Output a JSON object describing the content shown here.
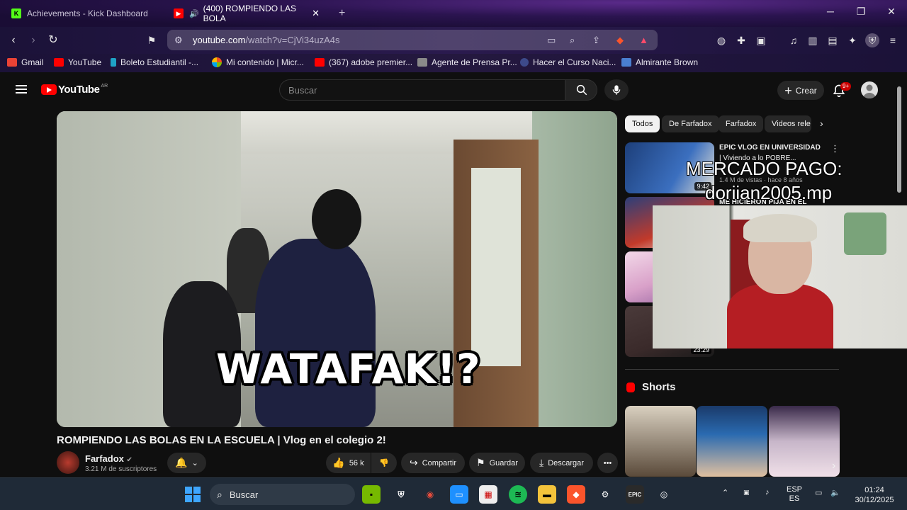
{
  "browser": {
    "tabs": [
      {
        "title": "Achievements - Kick Dashboard",
        "active": false,
        "icon": "kick-icon"
      },
      {
        "title": "(400) ROMPIENDO LAS BOLA",
        "active": true,
        "icon": "youtube-icon"
      }
    ],
    "url": {
      "host": "youtube.com",
      "path": "/watch?v=CjVi34uzA4s"
    },
    "bookmarks": [
      {
        "label": "Gmail",
        "color": "#ea4335"
      },
      {
        "label": "YouTube",
        "color": "#ff0000"
      },
      {
        "label": "Boleto Estudiantil -...",
        "color": "#1fa3c6"
      },
      {
        "label": "Mi contenido | Micr...",
        "color": "#f4b400"
      },
      {
        "label": "(367) adobe premier...",
        "color": "#ff0000"
      },
      {
        "label": "Agente de Prensa Pr...",
        "color": "#8a8a8a"
      },
      {
        "label": "Hacer el Curso Naci...",
        "color": "#3d4a8a"
      },
      {
        "label": "Almirante Brown",
        "color": "#4a7fd1"
      }
    ]
  },
  "youtube": {
    "logo_word": "YouTube",
    "country_code": "AR",
    "search_placeholder": "Buscar",
    "create_label": "Crear",
    "notif_badge": "9+",
    "video": {
      "overlay_text": "WATAFAK!?",
      "title": "ROMPIENDO LAS BOLAS EN LA ESCUELA | Vlog en el colegio 2!",
      "channel": "Farfadox",
      "subscribers": "3.21 M de suscriptores",
      "likes": "56 k",
      "share_label": "Compartir",
      "save_label": "Guardar",
      "download_label": "Descargar"
    },
    "chips": [
      "Todos",
      "De Farfadox",
      "Farfadox",
      "Videos rele"
    ],
    "recommendations": [
      {
        "title": "EPIC VLOG EN UNIVERSIDAD",
        "subtitle": "| Viviendo a lo POBRE...",
        "meta": "1.4 M de vistas · hace 8 años",
        "duration": "9:42",
        "thumb_color": "#3b6fbf"
      },
      {
        "title": "ME HICIERON PIJA EN EL",
        "subtitle": "",
        "meta": "",
        "duration": "",
        "thumb_color": "#c23a2a"
      },
      {
        "title": "",
        "subtitle": "",
        "meta": "",
        "duration": "",
        "thumb_color": "#d9a1c9"
      },
      {
        "title": "",
        "subtitle": "",
        "meta": "",
        "duration": "23:29",
        "thumb_color": "#3a2a2a"
      }
    ],
    "shorts_label": "Shorts",
    "shorts": [
      {
        "color": "#5a4a3a"
      },
      {
        "color": "#2a6ab0"
      },
      {
        "color": "#c7b6c9"
      }
    ]
  },
  "stream_overlay": {
    "line1": "MERCADO PAGO:",
    "line2": "doriian2005.mp"
  },
  "taskbar": {
    "search_label": "Buscar",
    "lang_top": "ESP",
    "lang_bottom": "ES",
    "time": "01:24",
    "date": "30/12/2025"
  }
}
